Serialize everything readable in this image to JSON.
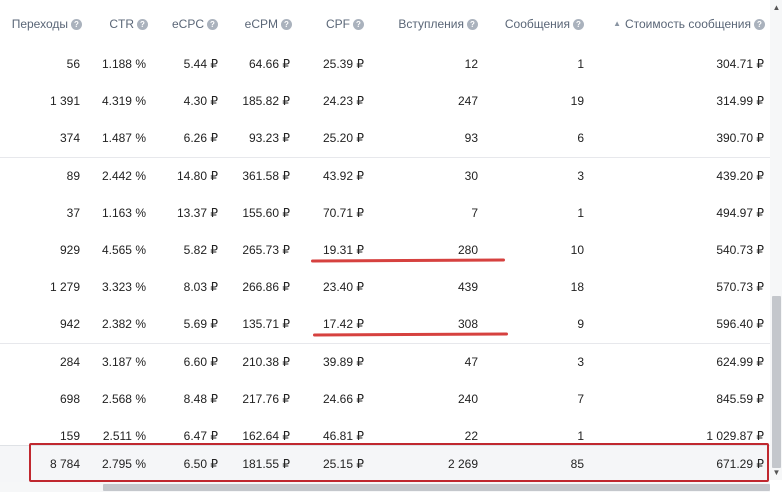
{
  "columns": [
    {
      "label": "Переходы"
    },
    {
      "label": "CTR"
    },
    {
      "label": "eCPC"
    },
    {
      "label": "eCPM"
    },
    {
      "label": "CPF"
    },
    {
      "label": "Вступления"
    },
    {
      "label": "Сообщения"
    },
    {
      "label": "Стоимость сообщения"
    }
  ],
  "help_glyph": "?",
  "sort_glyph": "▲",
  "rows": [
    [
      "56",
      "1.188 %",
      "5.44 ₽",
      "64.66 ₽",
      "25.39 ₽",
      "12",
      "1",
      "304.71 ₽"
    ],
    [
      "1 391",
      "4.319 %",
      "4.30 ₽",
      "185.82 ₽",
      "24.23 ₽",
      "247",
      "19",
      "314.99 ₽"
    ],
    [
      "374",
      "1.487 %",
      "6.26 ₽",
      "93.23 ₽",
      "25.20 ₽",
      "93",
      "6",
      "390.70 ₽"
    ],
    [
      "89",
      "2.442 %",
      "14.80 ₽",
      "361.58 ₽",
      "43.92 ₽",
      "30",
      "3",
      "439.20 ₽"
    ],
    [
      "37",
      "1.163 %",
      "13.37 ₽",
      "155.60 ₽",
      "70.71 ₽",
      "7",
      "1",
      "494.97 ₽"
    ],
    [
      "929",
      "4.565 %",
      "5.82 ₽",
      "265.73 ₽",
      "19.31 ₽",
      "280",
      "10",
      "540.73 ₽"
    ],
    [
      "1 279",
      "3.323 %",
      "8.03 ₽",
      "266.86 ₽",
      "23.40 ₽",
      "439",
      "18",
      "570.73 ₽"
    ],
    [
      "942",
      "2.382 %",
      "5.69 ₽",
      "135.71 ₽",
      "17.42 ₽",
      "308",
      "9",
      "596.40 ₽"
    ],
    [
      "284",
      "3.187 %",
      "6.60 ₽",
      "210.38 ₽",
      "39.89 ₽",
      "47",
      "3",
      "624.99 ₽"
    ],
    [
      "698",
      "2.568 %",
      "8.48 ₽",
      "217.76 ₽",
      "24.66 ₽",
      "240",
      "7",
      "845.59 ₽"
    ],
    [
      "159",
      "2.511 %",
      "6.47 ₽",
      "162.64 ₽",
      "46.81 ₽",
      "22",
      "1",
      "1 029.87 ₽"
    ]
  ],
  "totals": [
    "8 784",
    "2.795 %",
    "6.50 ₽",
    "181.55 ₽",
    "25.15 ₽",
    "2 269",
    "85",
    "671.29 ₽"
  ],
  "colors": {
    "highlight_box": "#c0282f",
    "underline": "#d6413f"
  }
}
